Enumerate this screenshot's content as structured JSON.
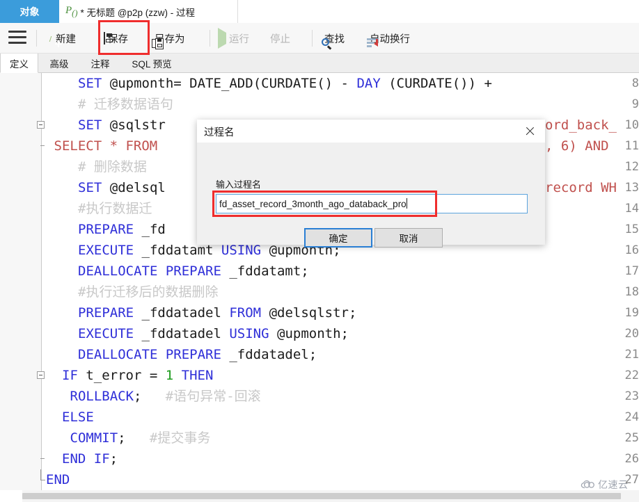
{
  "tabstrip": {
    "object_tab": "对象",
    "doc_tab": "* 无标题 @p2p (zzw) - 过程",
    "doc_icon": "procedure-icon"
  },
  "toolbar": {
    "menu_icon": "hamburger-menu-icon",
    "items": [
      {
        "label": "新建",
        "icon": "new-icon",
        "enabled": true
      },
      {
        "label": "保存",
        "icon": "save-floppy-icon",
        "enabled": true
      },
      {
        "label": "另存为",
        "icon": "save-as-icon",
        "enabled": true
      },
      {
        "label": "运行",
        "icon": "run-play-icon",
        "enabled": false
      },
      {
        "label": "停止",
        "icon": "stop-square-icon",
        "enabled": false
      },
      {
        "label": "查找",
        "icon": "search-magnifier-icon",
        "enabled": true
      },
      {
        "label": "自动换行",
        "icon": "word-wrap-icon",
        "enabled": true
      }
    ],
    "highlight_color": "#ef2d2d"
  },
  "subtabs": {
    "items": [
      "定义",
      "高级",
      "注释",
      "SQL 预览"
    ],
    "active_index": 0
  },
  "editor": {
    "first_line_number": 8,
    "lines": [
      {
        "n": 8,
        "fold": "none",
        "indent": 4,
        "tokens": [
          {
            "t": "SET",
            "c": "kw"
          },
          {
            "t": " @upmonth= ",
            "c": "pl"
          },
          {
            "t": "DATE_ADD",
            "c": "pl"
          },
          {
            "t": "(",
            "c": "pl"
          },
          {
            "t": "CURDATE",
            "c": "pl"
          },
          {
            "t": "()",
            "c": "pl"
          },
          {
            "t": " - ",
            "c": "pl"
          },
          {
            "t": "DAY",
            "c": "kw"
          },
          {
            "t": " (",
            "c": "pl"
          },
          {
            "t": "CURDATE",
            "c": "pl"
          },
          {
            "t": "())",
            "c": "pl"
          },
          {
            "t": " +",
            "c": "pl"
          }
        ]
      },
      {
        "n": 9,
        "fold": "none",
        "indent": 4,
        "tokens": [
          {
            "t": "# 迁移数据语句",
            "c": "cmt"
          }
        ]
      },
      {
        "n": 10,
        "fold": "box",
        "indent": 4,
        "tokens": [
          {
            "t": "SET",
            "c": "kw"
          },
          {
            "t": " @sqlstr",
            "c": "pl"
          }
        ]
      },
      {
        "n": 11,
        "fold": "tick",
        "indent": 1,
        "tokens": [
          {
            "t": "SELECT * FROM",
            "c": "str"
          }
        ]
      },
      {
        "n": 12,
        "fold": "none",
        "indent": 4,
        "tokens": [
          {
            "t": "# 删除数据",
            "c": "cmt"
          }
        ]
      },
      {
        "n": 13,
        "fold": "none",
        "indent": 4,
        "tokens": [
          {
            "t": "SET",
            "c": "kw"
          },
          {
            "t": " @delsql",
            "c": "pl"
          }
        ]
      },
      {
        "n": 14,
        "fold": "none",
        "indent": 4,
        "tokens": [
          {
            "t": "#执行数据迁",
            "c": "cmt"
          }
        ]
      },
      {
        "n": 15,
        "fold": "none",
        "indent": 4,
        "tokens": [
          {
            "t": "PREPARE",
            "c": "kw"
          },
          {
            "t": " _fd",
            "c": "pl"
          }
        ]
      },
      {
        "n": 16,
        "fold": "none",
        "indent": 4,
        "tokens": [
          {
            "t": "EXECUTE",
            "c": "kw"
          },
          {
            "t": " _fddatamt ",
            "c": "pl"
          },
          {
            "t": "USING",
            "c": "kw"
          },
          {
            "t": " @upmonth;",
            "c": "pl"
          }
        ]
      },
      {
        "n": 17,
        "fold": "none",
        "indent": 4,
        "tokens": [
          {
            "t": "DEALLOCATE PREPARE",
            "c": "kw"
          },
          {
            "t": " _fddatamt;",
            "c": "pl"
          }
        ]
      },
      {
        "n": 18,
        "fold": "none",
        "indent": 4,
        "tokens": [
          {
            "t": "#执行迁移后的数据删除",
            "c": "cmt"
          }
        ]
      },
      {
        "n": 19,
        "fold": "none",
        "indent": 4,
        "tokens": [
          {
            "t": "PREPARE",
            "c": "kw"
          },
          {
            "t": " _fddatadel ",
            "c": "pl"
          },
          {
            "t": "FROM",
            "c": "kw"
          },
          {
            "t": " @delsqlstr;",
            "c": "pl"
          }
        ]
      },
      {
        "n": 20,
        "fold": "none",
        "indent": 4,
        "tokens": [
          {
            "t": "EXECUTE",
            "c": "kw"
          },
          {
            "t": " _fddatadel ",
            "c": "pl"
          },
          {
            "t": "USING",
            "c": "kw"
          },
          {
            "t": " @upmonth;",
            "c": "pl"
          }
        ]
      },
      {
        "n": 21,
        "fold": "none",
        "indent": 4,
        "tokens": [
          {
            "t": "DEALLOCATE PREPARE",
            "c": "kw"
          },
          {
            "t": " _fddatadel;",
            "c": "pl"
          }
        ]
      },
      {
        "n": 22,
        "fold": "box",
        "indent": 2,
        "tokens": [
          {
            "t": "IF",
            "c": "kw"
          },
          {
            "t": " t_error = ",
            "c": "pl"
          },
          {
            "t": "1",
            "c": "num"
          },
          {
            "t": " ",
            "c": "pl"
          },
          {
            "t": "THEN",
            "c": "kw"
          }
        ]
      },
      {
        "n": 23,
        "fold": "none",
        "indent": 3,
        "tokens": [
          {
            "t": "ROLLBACK",
            "c": "kw"
          },
          {
            "t": ";",
            "c": "pl"
          },
          {
            "t": "   #语句异常-回滚",
            "c": "cmt"
          }
        ]
      },
      {
        "n": 24,
        "fold": "none",
        "indent": 2,
        "tokens": [
          {
            "t": "ELSE",
            "c": "kw"
          }
        ]
      },
      {
        "n": 25,
        "fold": "none",
        "indent": 3,
        "tokens": [
          {
            "t": "COMMIT",
            "c": "kw"
          },
          {
            "t": ";",
            "c": "pl"
          },
          {
            "t": "   #提交事务",
            "c": "cmt"
          }
        ]
      },
      {
        "n": 26,
        "fold": "tick",
        "indent": 2,
        "tokens": [
          {
            "t": "END IF",
            "c": "kw"
          },
          {
            "t": ";",
            "c": "pl"
          }
        ]
      },
      {
        "n": 27,
        "fold": "corner",
        "indent": 0,
        "tokens": [
          {
            "t": "END",
            "c": "kw"
          }
        ]
      }
    ],
    "right_fragments": [
      {
        "line": 10,
        "text": "ord_back_"
      },
      {
        "line": 11,
        "text": ", 6) AND"
      },
      {
        "line": 13,
        "text": "record WH"
      }
    ]
  },
  "dialog": {
    "title": "过程名",
    "close_icon": "close-x-icon",
    "field_label": "输入过程名",
    "field_value": "fd_asset_record_3month_ago_databack_pro",
    "ok_label": "确定",
    "cancel_label": "取消",
    "highlight_color": "#ef2d2d",
    "focus_color": "#2a7fd4"
  },
  "watermark": {
    "text": "亿速云",
    "icon": "cloud-logo-icon"
  }
}
